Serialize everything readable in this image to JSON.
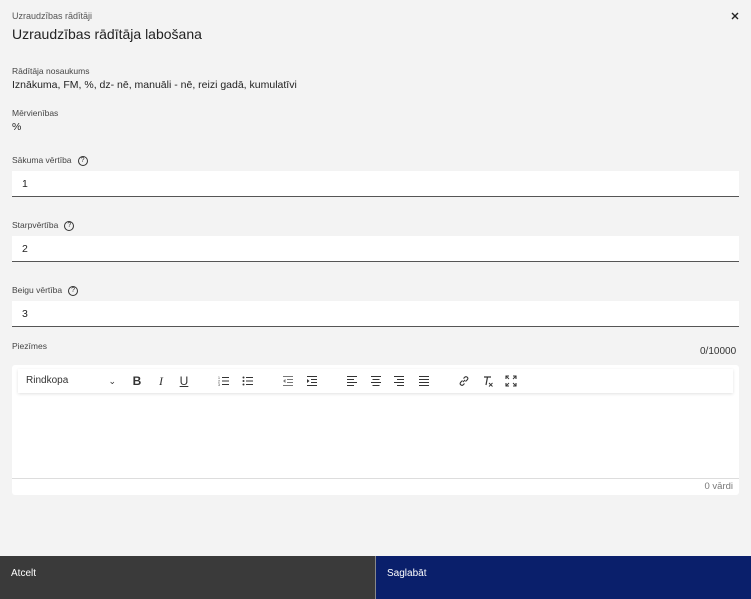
{
  "header": {
    "breadcrumb": "Uzraudzības rādītāji",
    "title": "Uzraudzības rādītāja labošana"
  },
  "fields": {
    "name": {
      "label": "Rādītāja nosaukums",
      "value": "Iznākuma, FM, %, dz- nē, manuāli - nē, reizi gadā, kumulatīvi"
    },
    "unit": {
      "label": "Mērvienības",
      "value": "%"
    },
    "start": {
      "label": "Sākuma vērtība",
      "value": "1"
    },
    "mid": {
      "label": "Starpvērtība",
      "value": "2"
    },
    "end": {
      "label": "Beigu vērtība",
      "value": "3"
    }
  },
  "notes": {
    "label": "Piezīmes",
    "counter": "0/10000",
    "paragraph_select": "Rindkopa",
    "word_count": "0 vārdi",
    "toolbar_icons": [
      "bold-icon",
      "italic-icon",
      "underline-icon",
      "numbered-list-icon",
      "bulleted-list-icon",
      "outdent-icon",
      "indent-icon",
      "align-left-icon",
      "align-center-icon",
      "align-right-icon",
      "align-justify-icon",
      "link-icon",
      "clear-format-icon",
      "fullscreen-icon"
    ]
  },
  "footer": {
    "cancel_label": "Atcelt",
    "save_label": "Saglabāt"
  },
  "colors": {
    "background": "#f3f3f3",
    "cancel_bg": "#3a3a3a",
    "save_bg": "#0a1f6b"
  }
}
